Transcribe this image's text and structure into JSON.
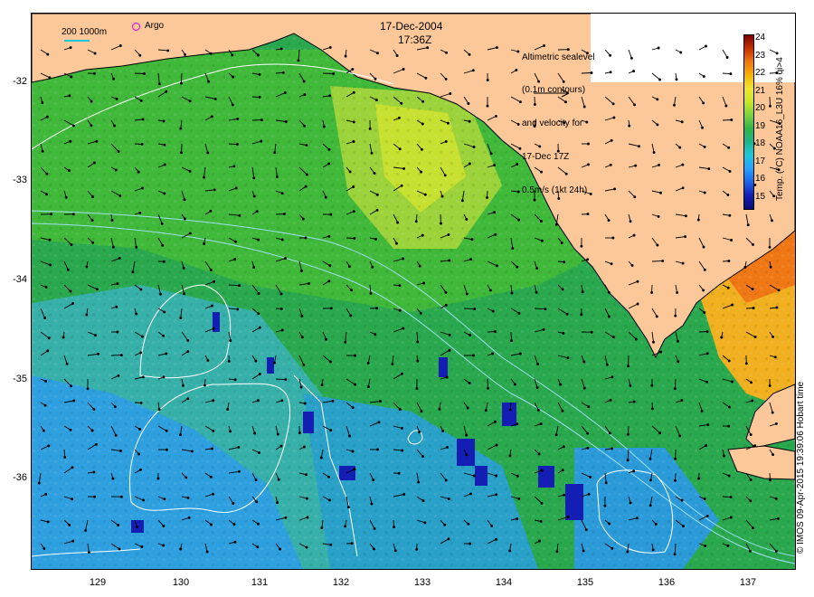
{
  "header": {
    "date": "17-Dec-2004",
    "time": "17:36Z"
  },
  "legend": {
    "lines": [
      "Altimetric sealevel",
      "(0.1m contours)",
      "and velocity for",
      "17-Dec 17Z",
      "0.5m/s (1kt 24h)"
    ]
  },
  "scale": {
    "label": "200  1000m"
  },
  "argo": {
    "label": "Argo",
    "color": "#e000e0"
  },
  "colorbar": {
    "ticks": [
      "24",
      "23",
      "22",
      "21",
      "20",
      "19",
      "18",
      "17",
      "16",
      "15"
    ],
    "title": "Temp. (°C) NOAA16_L3U 16% qi>4",
    "colors": [
      "#7a0000",
      "#c83200",
      "#f07814",
      "#f5b400",
      "#f0e632",
      "#c8e628",
      "#7ad23c",
      "#32b446",
      "#1eb48c",
      "#1ec8dc",
      "#28a0ff",
      "#1e64e6",
      "#141eb4",
      "#0a0a78"
    ]
  },
  "axes": {
    "lat_labels": [
      "-32",
      "-33",
      "-34",
      "-35",
      "-36"
    ],
    "lon_labels": [
      "129",
      "130",
      "131",
      "132",
      "133",
      "134",
      "135",
      "136",
      "137"
    ]
  },
  "colors": {
    "land": "#fcc89a",
    "ocean_warm": "#3cb43c",
    "ocean_cool": "#28a0e6",
    "coast": "#000000",
    "contour": "#ffffff",
    "isobath": "#a0e0f0"
  },
  "credit": "© IMOS 09-Apr-2015 19:39:06 Hobart time"
}
